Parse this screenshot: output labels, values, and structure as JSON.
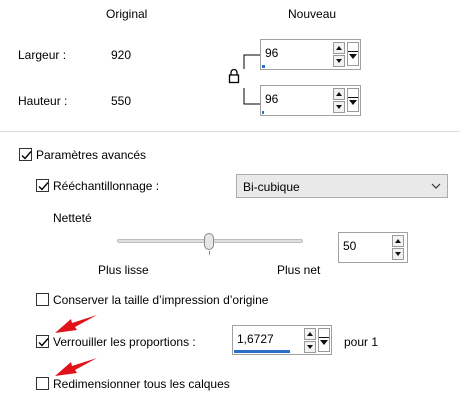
{
  "columns": {
    "original": "Original",
    "nouveau": "Nouveau"
  },
  "width": {
    "label": "Largeur :",
    "original": "920",
    "value": "96"
  },
  "height": {
    "label": "Hauteur :",
    "original": "550",
    "value": "96"
  },
  "advanced": {
    "label": "Paramètres avancés",
    "checked": true
  },
  "resample": {
    "label": "Rééchantillonnage :",
    "checked": true,
    "method": "Bi-cubique"
  },
  "sharpness": {
    "label": "Netteté",
    "min_label": "Plus lisse",
    "max_label": "Plus net",
    "value": "50"
  },
  "keep_print_size": {
    "label": "Conserver la taille d’impression d’origine",
    "checked": false
  },
  "lock_ratio": {
    "label": "Verrouiller les proportions :",
    "checked": true,
    "value": "1,6727",
    "suffix": "pour 1"
  },
  "resize_layers": {
    "label": "Redimensionner tous les calques",
    "checked": false
  },
  "icons": {
    "lock": "lock-icon",
    "arrow": "red-arrow-icon"
  },
  "colors": {
    "accent": "#2a6fc8",
    "arrow": "#e0121a"
  }
}
